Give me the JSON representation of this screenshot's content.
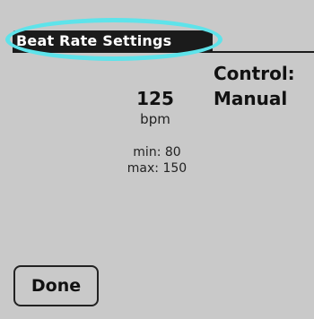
{
  "header": {
    "title": "Beat Rate Settings"
  },
  "rate": {
    "value": "125",
    "unit": "bpm"
  },
  "control": {
    "label": "Control:",
    "value": "Manual"
  },
  "limits": {
    "min": "min: 80",
    "max": "max: 150"
  },
  "actions": {
    "done_label": "Done"
  },
  "colors": {
    "background": "#c9c9c9",
    "title_bar": "#1b1b1b",
    "highlight": "#5ee3ea"
  }
}
